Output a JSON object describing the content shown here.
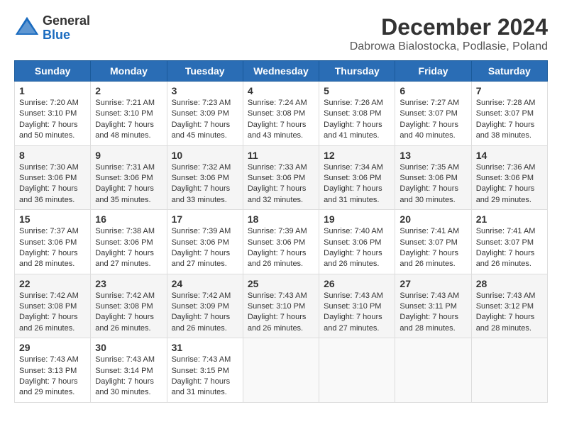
{
  "logo": {
    "general": "General",
    "blue": "Blue"
  },
  "title": "December 2024",
  "subtitle": "Dabrowa Bialostocka, Podlasie, Poland",
  "headers": [
    "Sunday",
    "Monday",
    "Tuesday",
    "Wednesday",
    "Thursday",
    "Friday",
    "Saturday"
  ],
  "rows": [
    [
      {
        "day": "1",
        "sunrise": "Sunrise: 7:20 AM",
        "sunset": "Sunset: 3:10 PM",
        "daylight": "Daylight: 7 hours and 50 minutes."
      },
      {
        "day": "2",
        "sunrise": "Sunrise: 7:21 AM",
        "sunset": "Sunset: 3:10 PM",
        "daylight": "Daylight: 7 hours and 48 minutes."
      },
      {
        "day": "3",
        "sunrise": "Sunrise: 7:23 AM",
        "sunset": "Sunset: 3:09 PM",
        "daylight": "Daylight: 7 hours and 45 minutes."
      },
      {
        "day": "4",
        "sunrise": "Sunrise: 7:24 AM",
        "sunset": "Sunset: 3:08 PM",
        "daylight": "Daylight: 7 hours and 43 minutes."
      },
      {
        "day": "5",
        "sunrise": "Sunrise: 7:26 AM",
        "sunset": "Sunset: 3:08 PM",
        "daylight": "Daylight: 7 hours and 41 minutes."
      },
      {
        "day": "6",
        "sunrise": "Sunrise: 7:27 AM",
        "sunset": "Sunset: 3:07 PM",
        "daylight": "Daylight: 7 hours and 40 minutes."
      },
      {
        "day": "7",
        "sunrise": "Sunrise: 7:28 AM",
        "sunset": "Sunset: 3:07 PM",
        "daylight": "Daylight: 7 hours and 38 minutes."
      }
    ],
    [
      {
        "day": "8",
        "sunrise": "Sunrise: 7:30 AM",
        "sunset": "Sunset: 3:06 PM",
        "daylight": "Daylight: 7 hours and 36 minutes."
      },
      {
        "day": "9",
        "sunrise": "Sunrise: 7:31 AM",
        "sunset": "Sunset: 3:06 PM",
        "daylight": "Daylight: 7 hours and 35 minutes."
      },
      {
        "day": "10",
        "sunrise": "Sunrise: 7:32 AM",
        "sunset": "Sunset: 3:06 PM",
        "daylight": "Daylight: 7 hours and 33 minutes."
      },
      {
        "day": "11",
        "sunrise": "Sunrise: 7:33 AM",
        "sunset": "Sunset: 3:06 PM",
        "daylight": "Daylight: 7 hours and 32 minutes."
      },
      {
        "day": "12",
        "sunrise": "Sunrise: 7:34 AM",
        "sunset": "Sunset: 3:06 PM",
        "daylight": "Daylight: 7 hours and 31 minutes."
      },
      {
        "day": "13",
        "sunrise": "Sunrise: 7:35 AM",
        "sunset": "Sunset: 3:06 PM",
        "daylight": "Daylight: 7 hours and 30 minutes."
      },
      {
        "day": "14",
        "sunrise": "Sunrise: 7:36 AM",
        "sunset": "Sunset: 3:06 PM",
        "daylight": "Daylight: 7 hours and 29 minutes."
      }
    ],
    [
      {
        "day": "15",
        "sunrise": "Sunrise: 7:37 AM",
        "sunset": "Sunset: 3:06 PM",
        "daylight": "Daylight: 7 hours and 28 minutes."
      },
      {
        "day": "16",
        "sunrise": "Sunrise: 7:38 AM",
        "sunset": "Sunset: 3:06 PM",
        "daylight": "Daylight: 7 hours and 27 minutes."
      },
      {
        "day": "17",
        "sunrise": "Sunrise: 7:39 AM",
        "sunset": "Sunset: 3:06 PM",
        "daylight": "Daylight: 7 hours and 27 minutes."
      },
      {
        "day": "18",
        "sunrise": "Sunrise: 7:39 AM",
        "sunset": "Sunset: 3:06 PM",
        "daylight": "Daylight: 7 hours and 26 minutes."
      },
      {
        "day": "19",
        "sunrise": "Sunrise: 7:40 AM",
        "sunset": "Sunset: 3:06 PM",
        "daylight": "Daylight: 7 hours and 26 minutes."
      },
      {
        "day": "20",
        "sunrise": "Sunrise: 7:41 AM",
        "sunset": "Sunset: 3:07 PM",
        "daylight": "Daylight: 7 hours and 26 minutes."
      },
      {
        "day": "21",
        "sunrise": "Sunrise: 7:41 AM",
        "sunset": "Sunset: 3:07 PM",
        "daylight": "Daylight: 7 hours and 26 minutes."
      }
    ],
    [
      {
        "day": "22",
        "sunrise": "Sunrise: 7:42 AM",
        "sunset": "Sunset: 3:08 PM",
        "daylight": "Daylight: 7 hours and 26 minutes."
      },
      {
        "day": "23",
        "sunrise": "Sunrise: 7:42 AM",
        "sunset": "Sunset: 3:08 PM",
        "daylight": "Daylight: 7 hours and 26 minutes."
      },
      {
        "day": "24",
        "sunrise": "Sunrise: 7:42 AM",
        "sunset": "Sunset: 3:09 PM",
        "daylight": "Daylight: 7 hours and 26 minutes."
      },
      {
        "day": "25",
        "sunrise": "Sunrise: 7:43 AM",
        "sunset": "Sunset: 3:10 PM",
        "daylight": "Daylight: 7 hours and 26 minutes."
      },
      {
        "day": "26",
        "sunrise": "Sunrise: 7:43 AM",
        "sunset": "Sunset: 3:10 PM",
        "daylight": "Daylight: 7 hours and 27 minutes."
      },
      {
        "day": "27",
        "sunrise": "Sunrise: 7:43 AM",
        "sunset": "Sunset: 3:11 PM",
        "daylight": "Daylight: 7 hours and 28 minutes."
      },
      {
        "day": "28",
        "sunrise": "Sunrise: 7:43 AM",
        "sunset": "Sunset: 3:12 PM",
        "daylight": "Daylight: 7 hours and 28 minutes."
      }
    ],
    [
      {
        "day": "29",
        "sunrise": "Sunrise: 7:43 AM",
        "sunset": "Sunset: 3:13 PM",
        "daylight": "Daylight: 7 hours and 29 minutes."
      },
      {
        "day": "30",
        "sunrise": "Sunrise: 7:43 AM",
        "sunset": "Sunset: 3:14 PM",
        "daylight": "Daylight: 7 hours and 30 minutes."
      },
      {
        "day": "31",
        "sunrise": "Sunrise: 7:43 AM",
        "sunset": "Sunset: 3:15 PM",
        "daylight": "Daylight: 7 hours and 31 minutes."
      },
      null,
      null,
      null,
      null
    ]
  ]
}
